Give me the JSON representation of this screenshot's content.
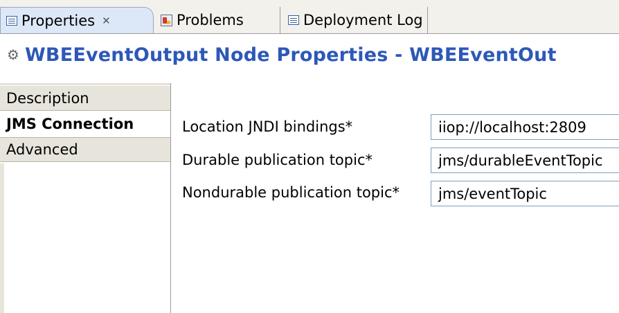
{
  "tabs": [
    {
      "label": "Properties",
      "icon": "properties-icon",
      "close": "✕"
    },
    {
      "label": "Problems",
      "icon": "problems-icon"
    },
    {
      "label": "Deployment Log",
      "icon": "deployment-log-icon"
    }
  ],
  "title": {
    "icon": "node-icon",
    "text": "WBEEventOutput Node Properties - WBEEventOut"
  },
  "sidebar": {
    "items": [
      {
        "label": "Description"
      },
      {
        "label": "JMS Connection"
      },
      {
        "label": "Advanced"
      }
    ]
  },
  "form": {
    "rows": [
      {
        "label": "Location JNDI bindings*",
        "value": "iiop://localhost:2809"
      },
      {
        "label": "Durable publication topic*",
        "value": "jms/durableEventTopic"
      },
      {
        "label": "Nondurable publication topic*",
        "value": "jms/eventTopic"
      }
    ]
  },
  "colors": {
    "accent": "#2d58b8",
    "active_tab": "#dce7f8",
    "section_bg": "#e7e4dc"
  }
}
